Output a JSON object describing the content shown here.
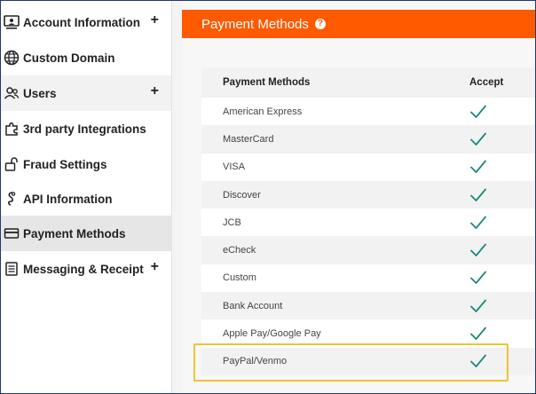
{
  "sidebar": {
    "items": [
      {
        "label": "Account Information",
        "icon": "monitor-user-icon",
        "plus": "+"
      },
      {
        "label": "Custom Domain",
        "icon": "globe-icon",
        "plus": ""
      },
      {
        "label": "Users",
        "icon": "users-icon",
        "plus": "+"
      },
      {
        "label": "3rd party Integrations",
        "icon": "puzzle-icon",
        "plus": ""
      },
      {
        "label": "Fraud Settings",
        "icon": "lock-icon",
        "plus": ""
      },
      {
        "label": "API Information",
        "icon": "api-icon",
        "plus": ""
      },
      {
        "label": "Payment Methods",
        "icon": "credit-card-icon",
        "plus": ""
      },
      {
        "label": "Messaging & Receipt",
        "icon": "receipt-icon",
        "plus": "+"
      }
    ],
    "active_index": 6
  },
  "header": {
    "title": "Payment Methods",
    "help_glyph": "?"
  },
  "table": {
    "columns": [
      "Payment Methods",
      "Accept"
    ],
    "rows": [
      {
        "name": "American Express",
        "accepted": true
      },
      {
        "name": "MasterCard",
        "accepted": true
      },
      {
        "name": "VISA",
        "accepted": true
      },
      {
        "name": "Discover",
        "accepted": true
      },
      {
        "name": "JCB",
        "accepted": true
      },
      {
        "name": "eCheck",
        "accepted": true
      },
      {
        "name": "Custom",
        "accepted": true
      },
      {
        "name": "Bank Account",
        "accepted": true
      },
      {
        "name": "Apple Pay/Google Pay",
        "accepted": true
      },
      {
        "name": "PayPal/Venmo",
        "accepted": true
      }
    ],
    "highlighted_row": "PayPal/Venmo"
  },
  "colors": {
    "header_bg": "#ff5a00",
    "check": "#1a8a78",
    "highlight_border": "#f0c232"
  }
}
